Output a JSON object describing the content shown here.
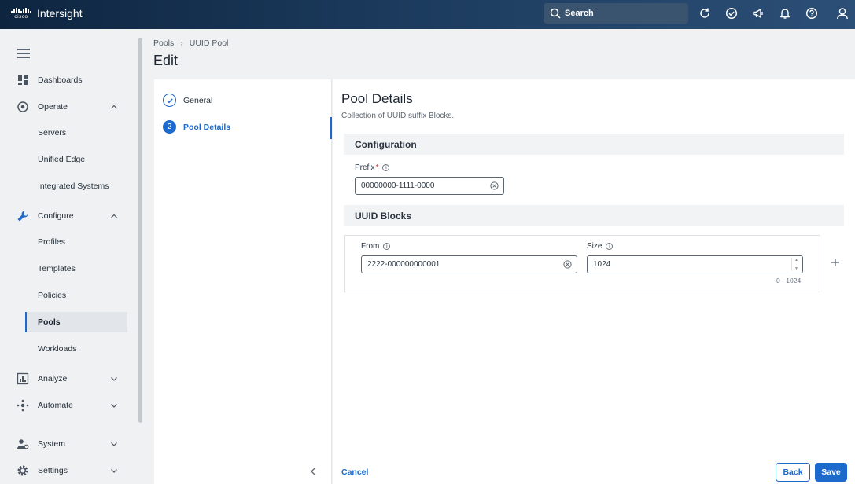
{
  "app": {
    "brand": "cisco",
    "name": "Intersight"
  },
  "search": {
    "label": "Search"
  },
  "sidebar": {
    "items": [
      {
        "label": "Dashboards"
      },
      {
        "label": "Operate"
      },
      {
        "label": "Servers"
      },
      {
        "label": "Unified Edge"
      },
      {
        "label": "Integrated Systems"
      },
      {
        "label": "Configure"
      },
      {
        "label": "Profiles"
      },
      {
        "label": "Templates"
      },
      {
        "label": "Policies"
      },
      {
        "label": "Pools"
      },
      {
        "label": "Workloads"
      },
      {
        "label": "Analyze"
      },
      {
        "label": "Automate"
      },
      {
        "label": "System"
      },
      {
        "label": "Settings"
      }
    ]
  },
  "breadcrumb": {
    "root": "Pools",
    "current": "UUID Pool"
  },
  "page": {
    "title": "Edit"
  },
  "steps": [
    {
      "number": "1",
      "label": "General",
      "state": "complete"
    },
    {
      "number": "2",
      "label": "Pool Details",
      "state": "active"
    }
  ],
  "main": {
    "title": "Pool Details",
    "description": "Collection of UUID suffix Blocks.",
    "configuration": {
      "header": "Configuration",
      "prefix_label": "Prefix",
      "prefix_required": "*",
      "prefix_value": "00000000-1111-0000"
    },
    "uuid_blocks": {
      "header": "UUID Blocks",
      "from_label": "From",
      "from_value": "2222-000000000001",
      "size_label": "Size",
      "size_value": "1024",
      "size_range": "0 - 1024"
    }
  },
  "footer": {
    "cancel": "Cancel",
    "back": "Back",
    "save": "Save"
  },
  "colors": {
    "accent": "#1d69cc",
    "topbar": "#1b3a5c",
    "required": "#d0312d"
  }
}
